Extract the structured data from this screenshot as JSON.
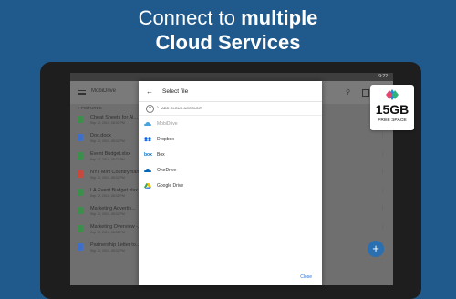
{
  "headline": {
    "line1_regular": "Connect to ",
    "line1_bold": "multiple",
    "line2": "Cloud Services"
  },
  "status": {
    "time": "9:22"
  },
  "app": {
    "title": "MobiDrive"
  },
  "breadcrumb": "> PICTURES",
  "files": [
    {
      "name": "Cheat Sheets for Al...",
      "meta": "Sep 12, 2019, 08:32 PM",
      "color": "#3c8f4a"
    },
    {
      "name": "Doc.docx",
      "meta": "Sep 12, 2019, 08:32 PM",
      "color": "#3f6fc8"
    },
    {
      "name": "Event Budget.xlsx",
      "meta": "Sep 12, 2019, 08:32 PM",
      "color": "#3c8f4a"
    },
    {
      "name": "NYJ Mini Countryman...",
      "meta": "Sep 12, 2019, 08:32 PM",
      "color": "#c9483c"
    },
    {
      "name": "LA Event Budget.xlsx",
      "meta": "Sep 12, 2019, 08:32 PM",
      "color": "#3c8f4a"
    },
    {
      "name": "Marketing Advertis...",
      "meta": "Sep 12, 2019, 08:32 PM",
      "color": "#3c8f4a"
    },
    {
      "name": "Marketing Overview -...",
      "meta": "Sep 12, 2019, 08:32 PM",
      "color": "#3c8f4a"
    },
    {
      "name": "Partnership Letter to...",
      "meta": "Sep 12, 2019, 08:32 PM",
      "color": "#3f6fc8"
    }
  ],
  "dialog": {
    "title": "Select file",
    "add_account": "ADD CLOUD ACCOUNT",
    "services": [
      {
        "label": "MobiDrive",
        "icon": "mobidrive-icon",
        "color": "#4aa3df"
      },
      {
        "label": "Dropbox",
        "icon": "dropbox-icon",
        "color": "#0061fe"
      },
      {
        "label": "Box",
        "icon": "box-icon",
        "color": "#0075c9"
      },
      {
        "label": "OneDrive",
        "icon": "onedrive-icon",
        "color": "#0364b8"
      },
      {
        "label": "Google Drive",
        "icon": "google-drive-icon",
        "color": "#34a853"
      }
    ],
    "close": "Close"
  },
  "fab": {
    "label": "+"
  },
  "badge": {
    "size": "15GB",
    "subtitle": "FREE SPACE"
  }
}
